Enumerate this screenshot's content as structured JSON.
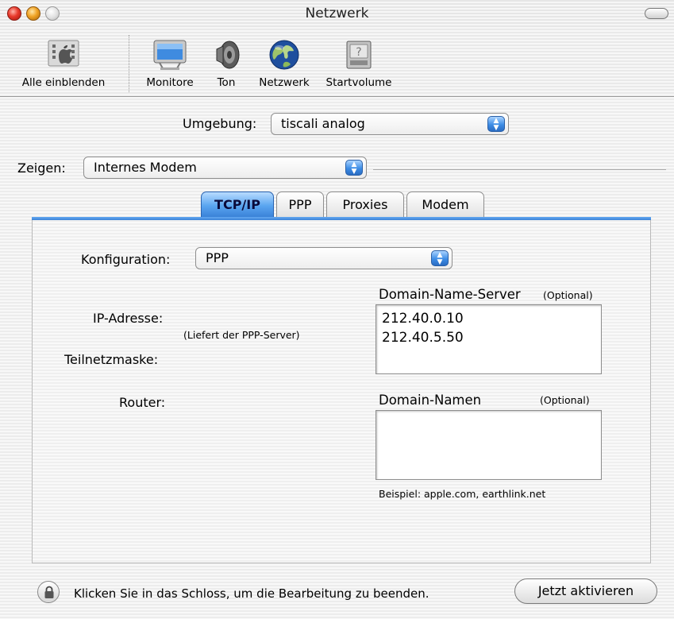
{
  "window": {
    "title": "Netzwerk"
  },
  "toolbar": {
    "items": [
      {
        "label": "Alle einblenden",
        "icon": "show-all-icon"
      },
      {
        "label": "Monitore",
        "icon": "monitor-icon"
      },
      {
        "label": "Ton",
        "icon": "speaker-icon"
      },
      {
        "label": "Netzwerk",
        "icon": "globe-icon"
      },
      {
        "label": "Startvolume",
        "icon": "disk-icon"
      }
    ]
  },
  "location": {
    "label": "Umgebung:",
    "value": "tiscali analog"
  },
  "show": {
    "label": "Zeigen:",
    "value": "Internes Modem"
  },
  "tabs": [
    {
      "label": "TCP/IP",
      "active": true
    },
    {
      "label": "PPP",
      "active": false
    },
    {
      "label": "Proxies",
      "active": false
    },
    {
      "label": "Modem",
      "active": false
    }
  ],
  "tcpip": {
    "config_label": "Konfiguration:",
    "config_value": "PPP",
    "ip_label": "IP-Adresse:",
    "ip_note": "(Liefert der PPP-Server)",
    "subnet_label": "Teilnetzmaske:",
    "router_label": "Router:",
    "dns_label": "Domain-Name-Server",
    "dns_optional": "(Optional)",
    "dns_entries": [
      "212.40.0.10",
      "212.40.5.50"
    ],
    "domains_label": "Domain-Namen",
    "domains_optional": "(Optional)",
    "domains_value": "",
    "example": "Beispiel: apple.com, earthlink.net"
  },
  "footer": {
    "lock_text": "Klicken Sie in das Schloss, um die Bearbeitung zu beenden.",
    "activate_label": "Jetzt aktivieren"
  },
  "colors": {
    "accent": "#3a82d8",
    "close": "#e8382a",
    "minimize": "#f0a325"
  }
}
